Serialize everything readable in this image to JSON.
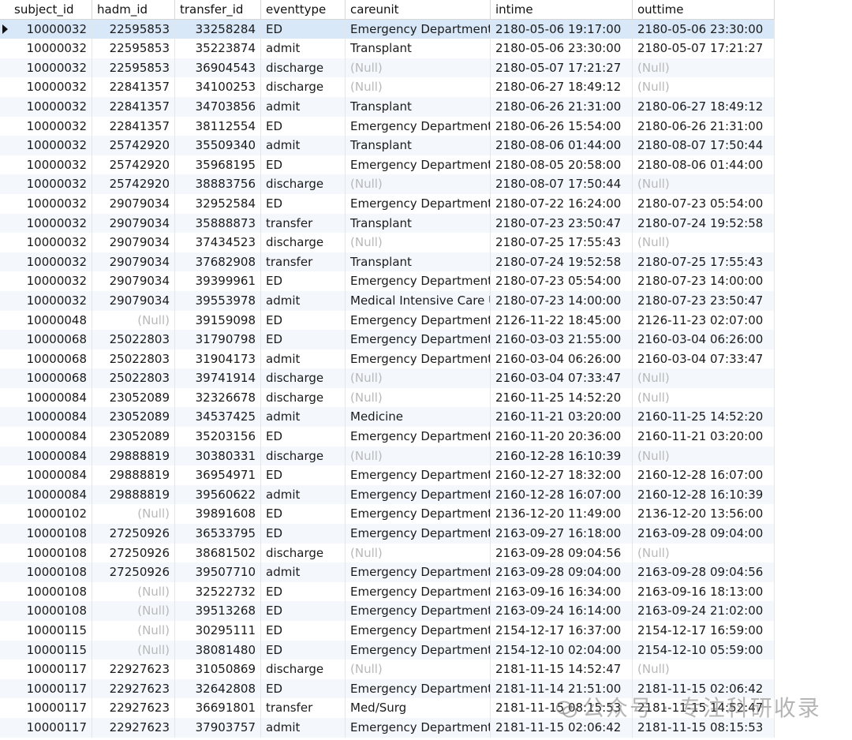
{
  "columns": [
    "subject_id",
    "hadm_id",
    "transfer_id",
    "eventtype",
    "careunit",
    "intime",
    "outtime"
  ],
  "null_label": "(Null)",
  "rows": [
    [
      "10000032",
      "22595853",
      "33258284",
      "ED",
      "Emergency Department",
      "2180-05-06 19:17:00",
      "2180-05-06 23:30:00"
    ],
    [
      "10000032",
      "22595853",
      "35223874",
      "admit",
      "Transplant",
      "2180-05-06 23:30:00",
      "2180-05-07 17:21:27"
    ],
    [
      "10000032",
      "22595853",
      "36904543",
      "discharge",
      null,
      "2180-05-07 17:21:27",
      null
    ],
    [
      "10000032",
      "22841357",
      "34100253",
      "discharge",
      null,
      "2180-06-27 18:49:12",
      null
    ],
    [
      "10000032",
      "22841357",
      "34703856",
      "admit",
      "Transplant",
      "2180-06-26 21:31:00",
      "2180-06-27 18:49:12"
    ],
    [
      "10000032",
      "22841357",
      "38112554",
      "ED",
      "Emergency Department",
      "2180-06-26 15:54:00",
      "2180-06-26 21:31:00"
    ],
    [
      "10000032",
      "25742920",
      "35509340",
      "admit",
      "Transplant",
      "2180-08-06 01:44:00",
      "2180-08-07 17:50:44"
    ],
    [
      "10000032",
      "25742920",
      "35968195",
      "ED",
      "Emergency Department",
      "2180-08-05 20:58:00",
      "2180-08-06 01:44:00"
    ],
    [
      "10000032",
      "25742920",
      "38883756",
      "discharge",
      null,
      "2180-08-07 17:50:44",
      null
    ],
    [
      "10000032",
      "29079034",
      "32952584",
      "ED",
      "Emergency Department",
      "2180-07-22 16:24:00",
      "2180-07-23 05:54:00"
    ],
    [
      "10000032",
      "29079034",
      "35888873",
      "transfer",
      "Transplant",
      "2180-07-23 23:50:47",
      "2180-07-24 19:52:58"
    ],
    [
      "10000032",
      "29079034",
      "37434523",
      "discharge",
      null,
      "2180-07-25 17:55:43",
      null
    ],
    [
      "10000032",
      "29079034",
      "37682908",
      "transfer",
      "Transplant",
      "2180-07-24 19:52:58",
      "2180-07-25 17:55:43"
    ],
    [
      "10000032",
      "29079034",
      "39399961",
      "ED",
      "Emergency Department",
      "2180-07-23 05:54:00",
      "2180-07-23 14:00:00"
    ],
    [
      "10000032",
      "29079034",
      "39553978",
      "admit",
      "Medical Intensive Care U",
      "2180-07-23 14:00:00",
      "2180-07-23 23:50:47"
    ],
    [
      "10000048",
      null,
      "39159098",
      "ED",
      "Emergency Department",
      "2126-11-22 18:45:00",
      "2126-11-23 02:07:00"
    ],
    [
      "10000068",
      "25022803",
      "31790798",
      "ED",
      "Emergency Department",
      "2160-03-03 21:55:00",
      "2160-03-04 06:26:00"
    ],
    [
      "10000068",
      "25022803",
      "31904173",
      "admit",
      "Emergency Department (",
      "2160-03-04 06:26:00",
      "2160-03-04 07:33:47"
    ],
    [
      "10000068",
      "25022803",
      "39741914",
      "discharge",
      null,
      "2160-03-04 07:33:47",
      null
    ],
    [
      "10000084",
      "23052089",
      "32326678",
      "discharge",
      null,
      "2160-11-25 14:52:20",
      null
    ],
    [
      "10000084",
      "23052089",
      "34537425",
      "admit",
      "Medicine",
      "2160-11-21 03:20:00",
      "2160-11-25 14:52:20"
    ],
    [
      "10000084",
      "23052089",
      "35203156",
      "ED",
      "Emergency Department",
      "2160-11-20 20:36:00",
      "2160-11-21 03:20:00"
    ],
    [
      "10000084",
      "29888819",
      "30380331",
      "discharge",
      null,
      "2160-12-28 16:10:39",
      null
    ],
    [
      "10000084",
      "29888819",
      "36954971",
      "ED",
      "Emergency Department",
      "2160-12-27 18:32:00",
      "2160-12-28 16:07:00"
    ],
    [
      "10000084",
      "29888819",
      "39560622",
      "admit",
      "Emergency Department (",
      "2160-12-28 16:07:00",
      "2160-12-28 16:10:39"
    ],
    [
      "10000102",
      null,
      "39891608",
      "ED",
      "Emergency Department",
      "2136-12-20 11:49:00",
      "2136-12-20 13:56:00"
    ],
    [
      "10000108",
      "27250926",
      "36533795",
      "ED",
      "Emergency Department",
      "2163-09-27 16:18:00",
      "2163-09-28 09:04:00"
    ],
    [
      "10000108",
      "27250926",
      "38681502",
      "discharge",
      null,
      "2163-09-28 09:04:56",
      null
    ],
    [
      "10000108",
      "27250926",
      "39507710",
      "admit",
      "Emergency Department (",
      "2163-09-28 09:04:00",
      "2163-09-28 09:04:56"
    ],
    [
      "10000108",
      null,
      "32522732",
      "ED",
      "Emergency Department",
      "2163-09-16 16:34:00",
      "2163-09-16 18:13:00"
    ],
    [
      "10000108",
      null,
      "39513268",
      "ED",
      "Emergency Department",
      "2163-09-24 16:14:00",
      "2163-09-24 21:02:00"
    ],
    [
      "10000115",
      null,
      "30295111",
      "ED",
      "Emergency Department",
      "2154-12-17 16:37:00",
      "2154-12-17 16:59:00"
    ],
    [
      "10000115",
      null,
      "38081480",
      "ED",
      "Emergency Department",
      "2154-12-10 02:04:00",
      "2154-12-10 05:59:00"
    ],
    [
      "10000117",
      "22927623",
      "31050869",
      "discharge",
      null,
      "2181-11-15 14:52:47",
      null
    ],
    [
      "10000117",
      "22927623",
      "32642808",
      "ED",
      "Emergency Department",
      "2181-11-14 21:51:00",
      "2181-11-15 02:06:42"
    ],
    [
      "10000117",
      "22927623",
      "36691801",
      "transfer",
      "Med/Surg",
      "2181-11-15 08:15:53",
      "2181-11-15 14:52:47"
    ],
    [
      "10000117",
      "22927623",
      "37903757",
      "admit",
      "Emergency Department (",
      "2181-11-15 02:06:42",
      "2181-11-15 08:15:53"
    ]
  ],
  "selected_row": 0,
  "watermark": {
    "text": "公众号 · 专注科研收录",
    "icon": "wechat-icon"
  }
}
